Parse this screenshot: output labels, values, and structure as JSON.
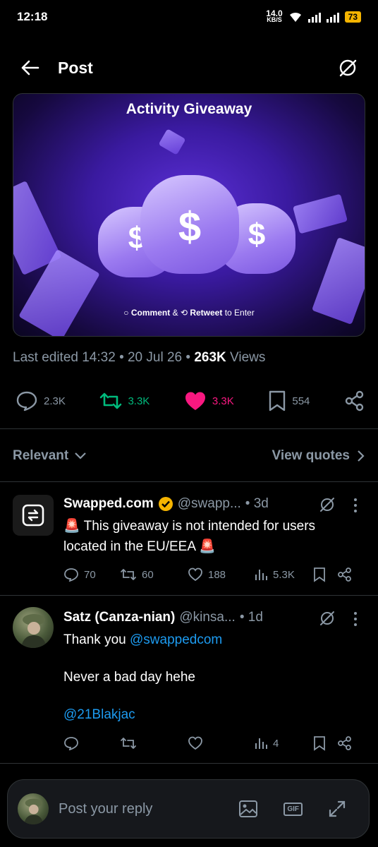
{
  "statusbar": {
    "time": "12:18",
    "net_speed": "14.0",
    "net_unit": "KB/S",
    "battery": "73"
  },
  "header": {
    "title": "Post"
  },
  "media": {
    "title": "Activity Giveaway",
    "cta_comment": "Comment",
    "cta_amp": "&",
    "cta_retweet": "Retweet",
    "cta_suffix": "to Enter",
    "colors": {
      "accent": "#5b2fd6"
    }
  },
  "meta": {
    "edited": "Last edited 14:32 • 20 Jul 26 •",
    "views_count": "263K",
    "views_label": "Views"
  },
  "actions": {
    "replies": "2.3K",
    "retweets": "3.3K",
    "likes": "3.3K",
    "bookmarks": "554"
  },
  "sort": {
    "relevant_label": "Relevant",
    "view_quotes_label": "View quotes"
  },
  "replies": [
    {
      "name": "Swapped.com",
      "handle": "@swapp...",
      "time": "• 3d",
      "text": "🚨 This giveaway is not intended for users located in the EU/EEA 🚨",
      "stats": {
        "replies": "70",
        "retweets": "60",
        "likes": "188",
        "views": "5.3K"
      }
    },
    {
      "name": "Satz (Canza-nian)",
      "handle": "@kinsa...",
      "time": "• 1d",
      "text_prefix": "Thank you ",
      "mention": "@swappedcom",
      "line2": "Never a bad day hehe",
      "mention2": "@21Blakjac",
      "stats": {
        "replies": "",
        "retweets": "",
        "likes": "",
        "views": "4"
      }
    }
  ],
  "composer": {
    "placeholder": "Post your reply",
    "gif_label": "GIF"
  },
  "colors": {
    "like": "#f91880",
    "retweet": "#00ba7c",
    "link": "#1d9bf0",
    "verified": "#f5b400"
  }
}
